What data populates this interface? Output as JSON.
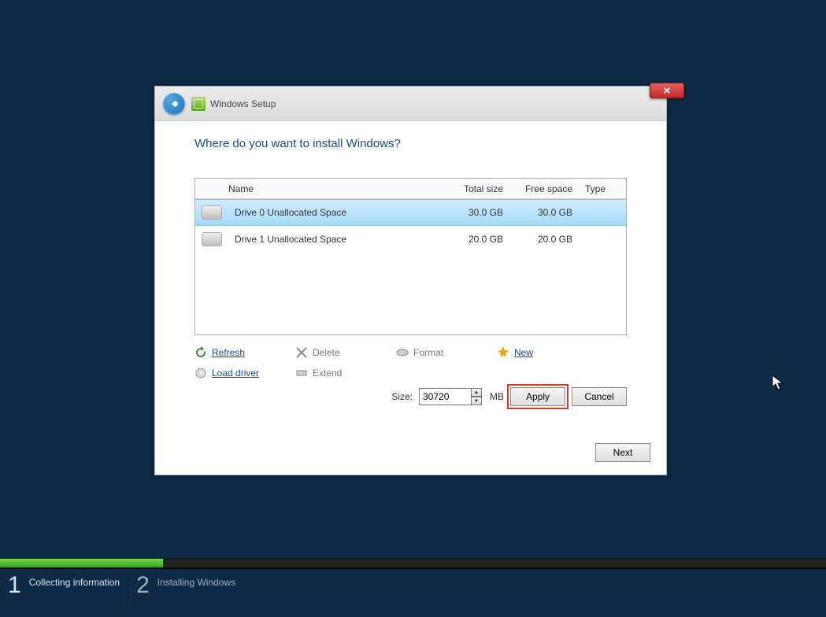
{
  "window": {
    "title": "Windows Setup"
  },
  "heading": "Where do you want to install Windows?",
  "columns": {
    "name": "Name",
    "total": "Total size",
    "free": "Free space",
    "type": "Type"
  },
  "drives": [
    {
      "name": "Drive 0 Unallocated Space",
      "total": "30.0 GB",
      "free": "30.0 GB",
      "type": "",
      "selected": true
    },
    {
      "name": "Drive 1 Unallocated Space",
      "total": "20.0 GB",
      "free": "20.0 GB",
      "type": "",
      "selected": false
    }
  ],
  "tools": {
    "refresh": "Refresh",
    "delete": "Delete",
    "format": "Format",
    "new": "New",
    "load_driver": "Load driver",
    "extend": "Extend"
  },
  "size": {
    "label": "Size:",
    "value": "30720",
    "unit": "MB"
  },
  "buttons": {
    "apply": "Apply",
    "cancel": "Cancel",
    "next": "Next"
  },
  "steps": [
    {
      "num": "1",
      "label": "Collecting information"
    },
    {
      "num": "2",
      "label": "Installing Windows"
    }
  ],
  "colors": {
    "accent": "#1a4a8e",
    "highlight": "#d33a2a"
  }
}
